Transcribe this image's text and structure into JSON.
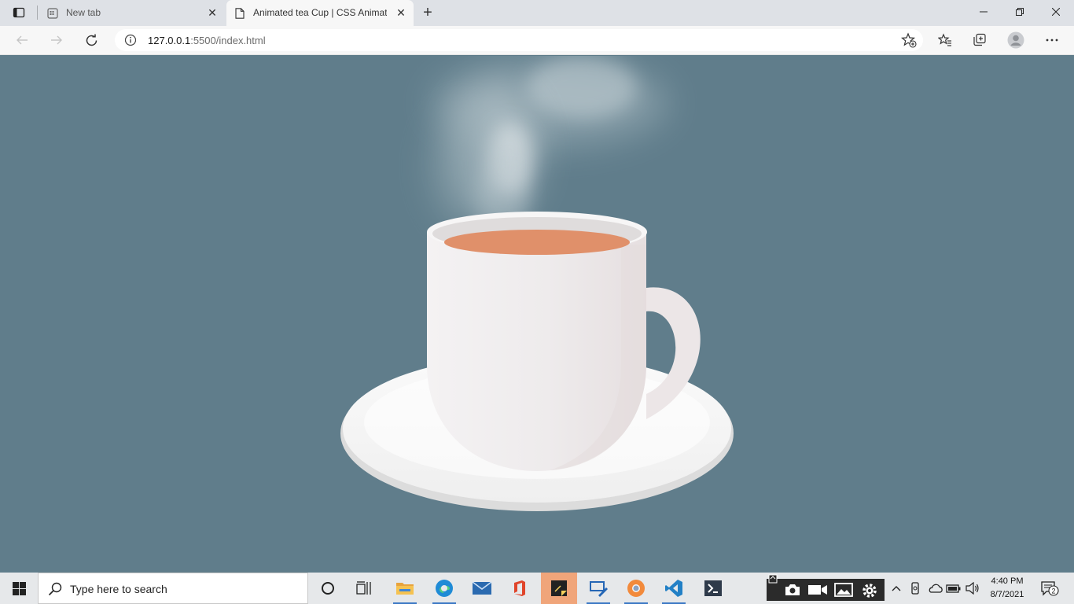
{
  "browser": {
    "tabs": [
      {
        "title": "New tab",
        "active": false
      },
      {
        "title": "Animated tea Cup | CSS Animation",
        "active": true
      }
    ],
    "close_glyph": "✕",
    "new_tab_glyph": "+",
    "address": {
      "host": "127.0.0.1",
      "rest": ":5500/index.html"
    },
    "window_controls": {
      "minimize": "—",
      "restore": "❐",
      "close": "✕"
    }
  },
  "page": {
    "background": "#607d8b",
    "tea_color": "#e0906a",
    "cup_color": "#f1eeef",
    "saucer_color": "#f3f3f3"
  },
  "taskbar": {
    "search_placeholder": "Type here to search",
    "time": "4:40 PM",
    "date": "8/7/2021",
    "notification_count": "2"
  }
}
